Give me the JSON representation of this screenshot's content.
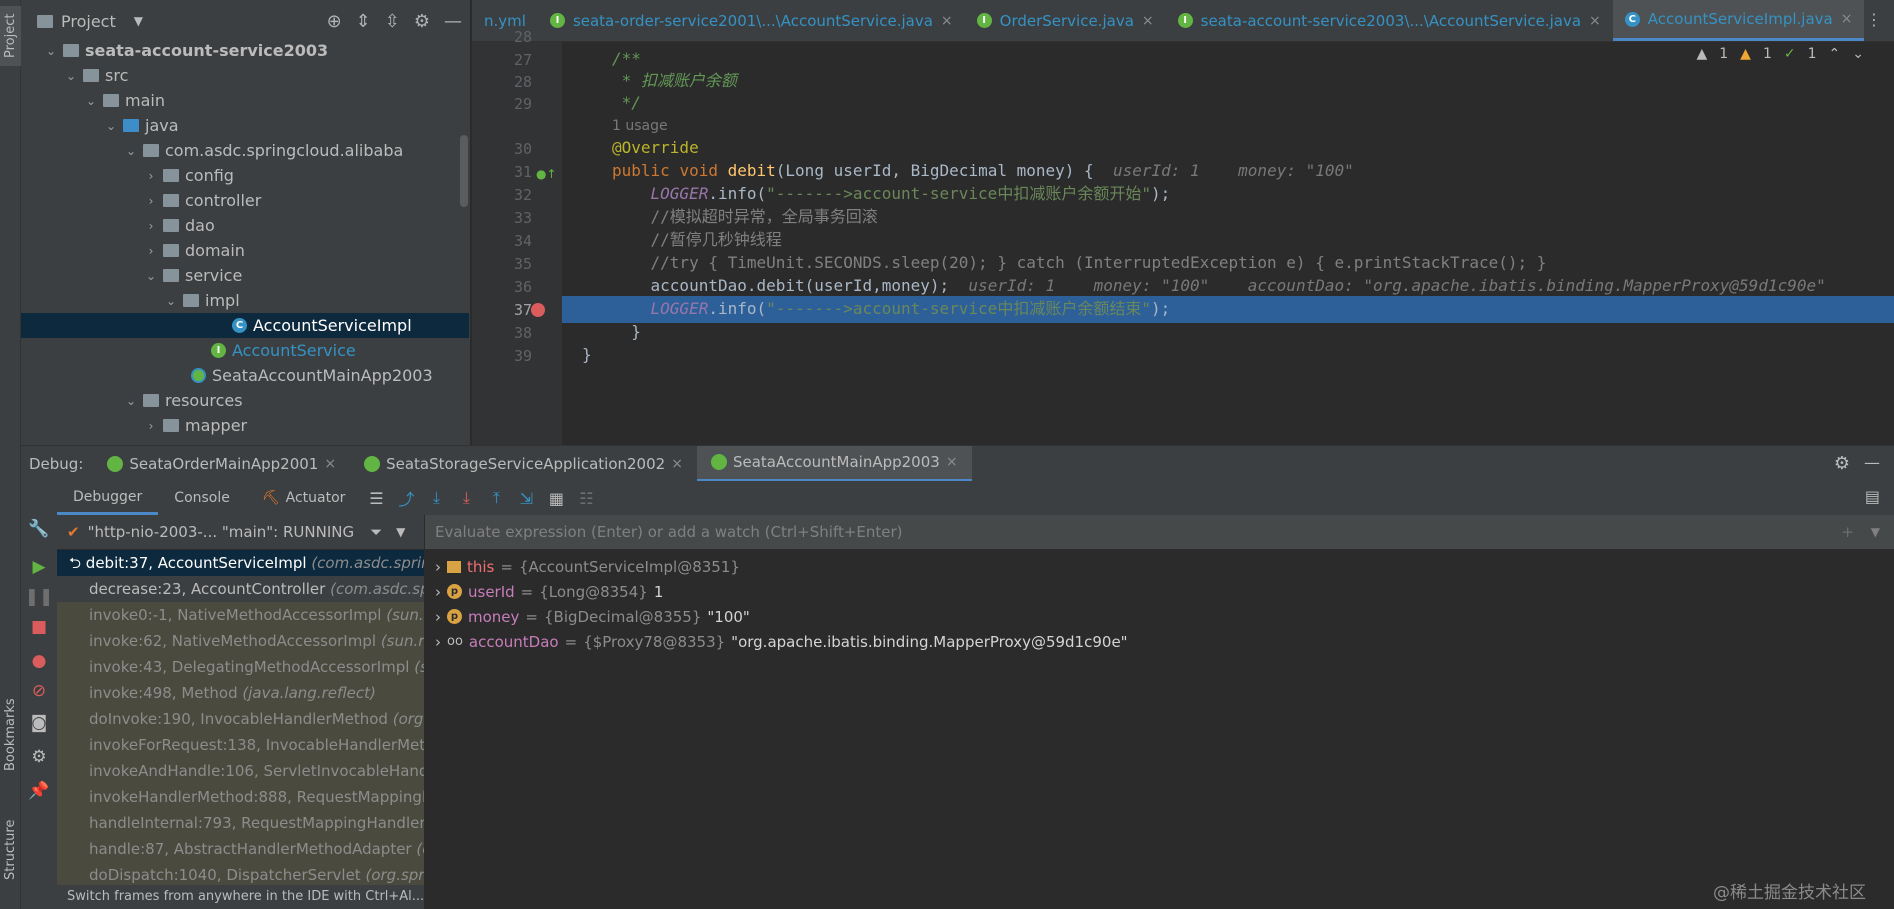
{
  "left_strip": {
    "top": "Project",
    "bookmarks": "Bookmarks",
    "structure": "Structure"
  },
  "project": {
    "title": "Project",
    "tree": [
      {
        "label": "seata-account-service2003",
        "bold": true
      },
      {
        "label": "src"
      },
      {
        "label": "main"
      },
      {
        "label": "java"
      },
      {
        "label": "com.asdc.springcloud.alibaba"
      },
      {
        "label": "config"
      },
      {
        "label": "controller"
      },
      {
        "label": "dao"
      },
      {
        "label": "domain"
      },
      {
        "label": "service"
      },
      {
        "label": "impl"
      },
      {
        "label": "AccountServiceImpl"
      },
      {
        "label": "AccountService"
      },
      {
        "label": "SeataAccountMainApp2003"
      },
      {
        "label": "resources"
      },
      {
        "label": "mapper"
      }
    ]
  },
  "editor_tabs": [
    {
      "label": "n.yml"
    },
    {
      "label": "seata-order-service2001\\...\\AccountService.java"
    },
    {
      "label": "OrderService.java"
    },
    {
      "label": "seata-account-service2003\\...\\AccountService.java"
    },
    {
      "label": "AccountServiceImpl.java"
    }
  ],
  "inspections": {
    "warn1": "1",
    "warn2": "1",
    "ok": "1"
  },
  "code": {
    "line_numbers": [
      "28",
      "27",
      "28",
      "29",
      "30",
      "31",
      "32",
      "33",
      "34",
      "35",
      "36",
      "37",
      "38",
      "39"
    ],
    "doc_open": "/**",
    "doc_body": " * 扣减账户余额",
    "doc_close": " */",
    "usage": "1 usage",
    "annotation": "@Override",
    "sig_public": "public",
    "sig_void": "void",
    "sig_name": "debit",
    "sig_params": "(Long userId, BigDecimal money) {",
    "sig_inline": "userId: 1    money: \"100\"",
    "l32_logger": "LOGGER",
    "l32_call": ".info(",
    "l32_str": "\"------->account-service中扣减账户余额开始\"",
    "l32_end": ");",
    "l33": "//模拟超时异常，全局事务回滚",
    "l34": "//暂停几秒钟线程",
    "l35": "//try { TimeUnit.SECONDS.sleep(20); } catch (InterruptedException e) { e.printStackTrace(); }",
    "l36_code": "accountDao.debit(userId,money);",
    "l36_inline": "userId: 1    money: \"100\"    accountDao: \"org.apache.ibatis.binding.MapperProxy@59d1c90e\"",
    "l37_logger": "LOGGER",
    "l37_call": ".info(",
    "l37_str": "\"------->account-service中扣减账户余额结束\"",
    "l37_end": ");",
    "l38": "}",
    "l39": "}"
  },
  "debug": {
    "label": "Debug:",
    "sessions": [
      "SeataOrderMainApp2001",
      "SeataStorageServiceApplication2002",
      "SeataAccountMainApp2003"
    ],
    "subtabs": [
      "Debugger",
      "Console",
      "Actuator"
    ],
    "thread": "\"http-nio-2003-... \"main\": RUNNING",
    "frames": [
      {
        "method": "debit:37, AccountServiceImpl",
        "pkg": "(com.asdc.sprin"
      },
      {
        "method": "decrease:23, AccountController",
        "pkg": "(com.asdc.spr"
      },
      {
        "method": "invoke0:-1, NativeMethodAccessorImpl",
        "pkg": "(sun.r"
      },
      {
        "method": "invoke:62, NativeMethodAccessorImpl",
        "pkg": "(sun.re"
      },
      {
        "method": "invoke:43, DelegatingMethodAccessorImpl",
        "pkg": "(s"
      },
      {
        "method": "invoke:498, Method",
        "pkg": "(java.lang.reflect)"
      },
      {
        "method": "doInvoke:190, InvocableHandlerMethod",
        "pkg": "(org."
      },
      {
        "method": "invokeForRequest:138, InvocableHandlerMeth",
        "pkg": ""
      },
      {
        "method": "invokeAndHandle:106, ServletInvocableHandl",
        "pkg": ""
      },
      {
        "method": "invokeHandlerMethod:888, RequestMappingl",
        "pkg": ""
      },
      {
        "method": "handleInternal:793, RequestMappingHandlerA",
        "pkg": ""
      },
      {
        "method": "handle:87, AbstractHandlerMethodAdapter",
        "pkg": "(c"
      },
      {
        "method": "doDispatch:1040, DispatcherServlet",
        "pkg": "(org.sprin"
      }
    ],
    "frames_footer": "Switch frames from anywhere in the IDE with Ctrl+Al...",
    "eval_placeholder": "Evaluate expression (Enter) or add a watch (Ctrl+Shift+Enter)",
    "variables": [
      {
        "name": "this",
        "type": "{AccountServiceImpl@8351}",
        "value": ""
      },
      {
        "name": "userId",
        "type": "{Long@8354}",
        "value": "1"
      },
      {
        "name": "money",
        "type": "{BigDecimal@8355}",
        "value": "\"100\""
      },
      {
        "name": "accountDao",
        "type": "{$Proxy78@8353}",
        "value": "\"org.apache.ibatis.binding.MapperProxy@59d1c90e\""
      }
    ]
  },
  "watermark": "@稀土掘金技术社区"
}
